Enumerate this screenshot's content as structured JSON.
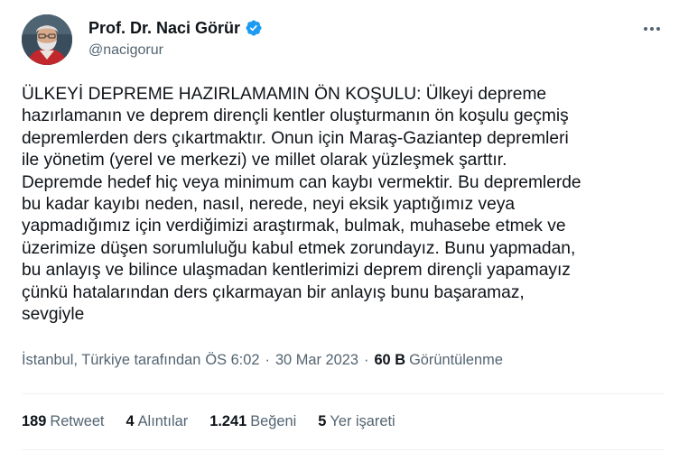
{
  "author": {
    "display_name": "Prof. Dr. Naci Görür",
    "handle": "@nacigorur",
    "verified_badge_color": "#1d9bf0"
  },
  "tweet": {
    "text": "ÜLKEYİ DEPREME HAZIRLAMAMIN ÖN KOŞULU: Ülkeyi depreme\nhazırlamanın ve deprem dirençli kentler oluşturmanın ön koşulu geçmiş\ndepremlerden ders çıkartmaktır. Onun için Maraş-Gaziantep depremleri\nile yönetim (yerel ve merkezi) ve millet olarak yüzleşmek şarttır.\nDepremde hedef hiç veya minimum can kaybı vermektir. Bu depremlerde\nbu kadar kayıbı neden, nasıl, nerede, neyi eksik yaptığımız veya\nyapmadığımız için verdiğimizi araştırmak, bulmak, muhasebe etmek ve\nüzerimize düşen sorumluluğu kabul etmek zorundayız. Bunu yapmadan,\nbu anlayış ve bilince ulaşmadan kentlerimizi deprem dirençli yapamayız\nçünkü hatalarından ders çıkarmayan bir anlayış bunu başaramaz,\nsevgiyle"
  },
  "meta": {
    "location": "İstanbul, Türkiye tarafından",
    "time": "ÖS 6:02",
    "date": "30 Mar 2023",
    "separator": "·",
    "views_count": "60 B",
    "views_label": "Görüntülenme"
  },
  "stats": {
    "retweets": {
      "count": "189",
      "label": "Retweet"
    },
    "quotes": {
      "count": "4",
      "label": "Alıntılar"
    },
    "likes": {
      "count": "1.241",
      "label": "Beğeni"
    },
    "bookmarks": {
      "count": "5",
      "label": "Yer işareti"
    }
  },
  "colors": {
    "text_primary": "#0f1419",
    "text_secondary": "#536471",
    "divider": "#eff3f4"
  },
  "icons": [
    "avatar-photo",
    "verified-badge-icon",
    "more-options-icon"
  ]
}
